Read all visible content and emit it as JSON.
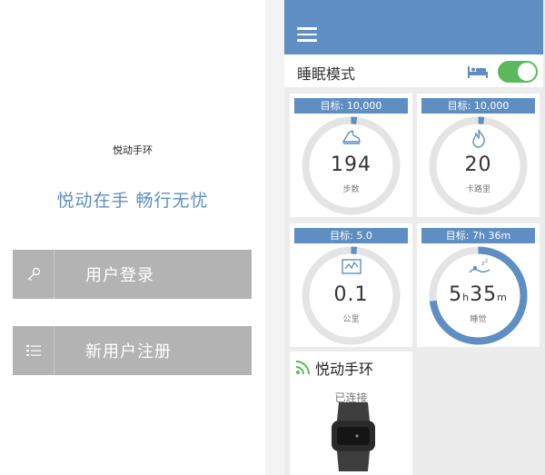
{
  "left_screen": {
    "app_name": "悦动手环",
    "slogan": "悦动在手 畅行无忧",
    "login_label": "用户登录",
    "register_label": "新用户注册"
  },
  "right_screen": {
    "sleep_mode_label": "睡眠模式",
    "sleep_mode_on": true,
    "cards": [
      {
        "goal": "目标: 10,000",
        "value": "194",
        "unit": "步数",
        "icon": "shoe-icon",
        "progress": 0.02
      },
      {
        "goal": "目标: 10,000",
        "value": "20",
        "unit": "卡路里",
        "icon": "flame-icon",
        "progress": 0.02
      },
      {
        "goal": "目标: 5.0",
        "value": "0.1",
        "unit": "公里",
        "icon": "chart-icon",
        "progress": 0.02
      },
      {
        "goal": "目标: 7h 36m",
        "value_h": "5",
        "value_h_unit": "h",
        "value_m": "35",
        "value_m_unit": "m",
        "unit": "睡觉",
        "icon": "sleep-icon",
        "progress": 0.73
      }
    ],
    "device": {
      "name": "悦动手环",
      "status": "已连接"
    }
  },
  "colors": {
    "accent": "#5e8ec2",
    "toggle_on": "#5cb85c",
    "auth_button": "#b3b3b3",
    "ring_track": "#e4e4e4"
  }
}
